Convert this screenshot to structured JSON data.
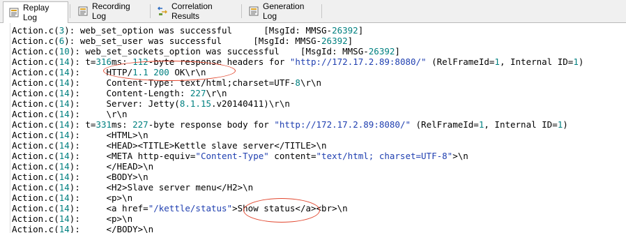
{
  "tabs": [
    {
      "label": "Replay Log",
      "icon": "replay-log-icon"
    },
    {
      "label": "Recording Log",
      "icon": "recording-log-icon"
    },
    {
      "label": "Correlation Results",
      "icon": "correlation-results-icon"
    },
    {
      "label": "Generation Log",
      "icon": "generation-log-icon"
    }
  ],
  "log_lines": [
    {
      "pre": "Action.c(",
      "num": "3",
      "post": "): web_set_option was successful      [MsgId: MMSG-",
      "num2": "26392",
      "post2": "]"
    },
    {
      "pre": "Action.c(",
      "num": "6",
      "post": "): web_set_user was successful      [MsgId: MMSG-",
      "num2": "26392",
      "post2": "]"
    },
    {
      "pre": "Action.c(",
      "num": "10",
      "post": "): web_set_sockets_option was successful    [MsgId: MMSG-",
      "num2": "26392",
      "post2": "]"
    },
    {
      "pre": "Action.c(",
      "num": "14",
      "post": "): t=",
      "num2": "316",
      "post2": "ms: ",
      "num3": "112",
      "post3": "-byte response headers for ",
      "str": "\"http://172.17.2.89:8080/\"",
      "post4": " (RelFrameId=",
      "num4": "1",
      "post5": ", Internal ID=",
      "num5": "1",
      "post6": ")"
    },
    {
      "pre": "Action.c(",
      "num": "14",
      "post": "):     HTTP/",
      "num2": "1.1",
      "post2": " ",
      "num3": "200",
      "post3": " OK\\r\\n"
    },
    {
      "pre": "Action.c(",
      "num": "14",
      "post": "):     Content-Type: text/html;charset=UTF-",
      "num2": "8",
      "post2": "\\r\\n"
    },
    {
      "pre": "Action.c(",
      "num": "14",
      "post": "):     Content-Length: ",
      "num2": "227",
      "post2": "\\r\\n"
    },
    {
      "pre": "Action.c(",
      "num": "14",
      "post": "):     Server: Jetty(",
      "num2": "8.1.15",
      "post2": ".v20140411)\\r\\n"
    },
    {
      "pre": "Action.c(",
      "num": "14",
      "post": "):     \\r\\n"
    },
    {
      "pre": "Action.c(",
      "num": "14",
      "post": "): t=",
      "num2": "331",
      "post2": "ms: ",
      "num3": "227",
      "post3": "-byte response body for ",
      "str": "\"http://172.17.2.89:8080/\"",
      "post4": " (RelFrameId=",
      "num4": "1",
      "post5": ", Internal ID=",
      "num5": "1",
      "post6": ")"
    },
    {
      "pre": "Action.c(",
      "num": "14",
      "post": "):     <HTML>\\n"
    },
    {
      "pre": "Action.c(",
      "num": "14",
      "post": "):     <HEAD><TITLE>Kettle slave server</TITLE>\\n"
    },
    {
      "pre": "Action.c(",
      "num": "14",
      "post": "):     <META http-equiv=",
      "str": "\"Content-Type\"",
      "post4": " content=",
      "str2": "\"text/html; charset=UTF-8\"",
      "post5": ">\\n"
    },
    {
      "pre": "Action.c(",
      "num": "14",
      "post": "):     </HEAD>\\n"
    },
    {
      "pre": "Action.c(",
      "num": "14",
      "post": "):     <BODY>\\n"
    },
    {
      "pre": "Action.c(",
      "num": "14",
      "post": "):     <H2>Slave server menu</H2>\\n"
    },
    {
      "pre": "Action.c(",
      "num": "14",
      "post": "):     <p>\\n"
    },
    {
      "pre": "Action.c(",
      "num": "14",
      "post": "):     <a href=",
      "str": "\"/kettle/status\"",
      "post4": ">Show status</a><br>\\n"
    },
    {
      "pre": "Action.c(",
      "num": "14",
      "post": "):     <p>\\n"
    },
    {
      "pre": "Action.c(",
      "num": "14",
      "post": "):     </BODY>\\n"
    }
  ],
  "colors": {
    "number": "#008080",
    "string": "#1f3fb0",
    "annotation": "#e2462e"
  }
}
